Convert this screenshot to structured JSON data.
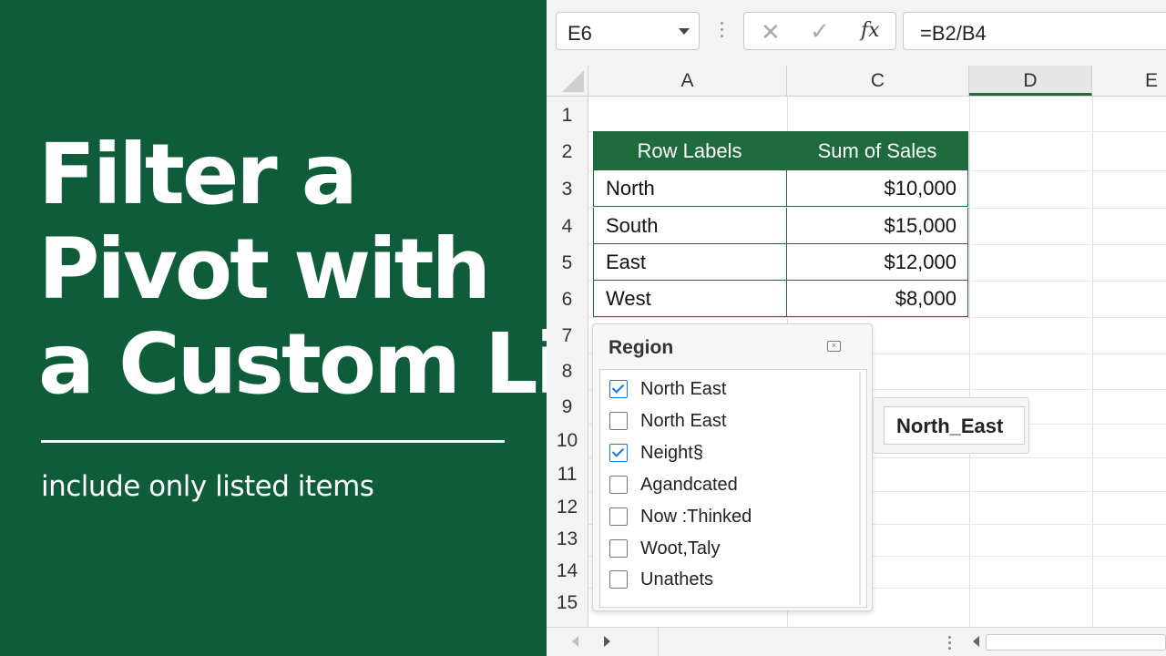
{
  "promo": {
    "title_lines": [
      "Filter a",
      "Pivot with",
      "a Custom List"
    ],
    "subtitle": "include only listed items"
  },
  "toolbar": {
    "name_box": "E6",
    "cancel_icon": "✕",
    "enter_icon": "✓",
    "fx_label": "fx",
    "formula": "=B2/B4"
  },
  "grid": {
    "columns": [
      "A",
      "C",
      "D",
      "E"
    ],
    "rows": [
      "1",
      "2",
      "3",
      "4",
      "5",
      "6",
      "7",
      "8",
      "9",
      "10",
      "11",
      "12",
      "13",
      "14",
      "15"
    ]
  },
  "pivot": {
    "headers": [
      "Row Labels",
      "Sum of Sales"
    ],
    "rows": [
      {
        "label": "North",
        "value": "$10,000"
      },
      {
        "label": "South",
        "value": "$15,000"
      },
      {
        "label": "East",
        "value": "$12,000"
      },
      {
        "label": "West",
        "value": "$8,000"
      }
    ]
  },
  "filter_panel": {
    "title": "Region",
    "items": [
      {
        "label": "North East",
        "checked": true
      },
      {
        "label": "North East",
        "checked": false
      },
      {
        "label": "Neight§",
        "checked": true
      },
      {
        "label": "Agandcated",
        "checked": false
      },
      {
        "label": "Now :Thinked",
        "checked": false
      },
      {
        "label": "Woot,Taly",
        "checked": false
      },
      {
        "label": "Unathets",
        "checked": false
      }
    ]
  },
  "name_tag": {
    "text": "North_East"
  }
}
